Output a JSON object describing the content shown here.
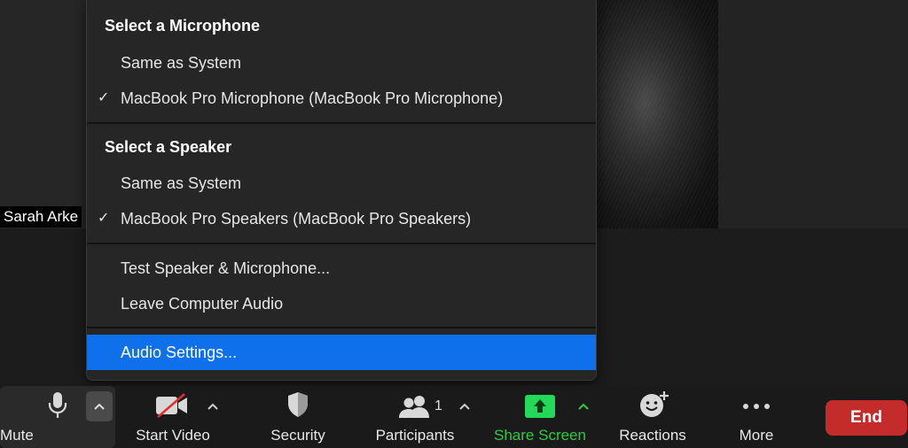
{
  "video": {
    "participant_name": "Sarah Arke"
  },
  "audio_menu": {
    "microphone_header": "Select a Microphone",
    "microphone_options": [
      {
        "label": "Same as System",
        "checked": false
      },
      {
        "label": "MacBook Pro Microphone (MacBook Pro Microphone)",
        "checked": true
      }
    ],
    "speaker_header": "Select a Speaker",
    "speaker_options": [
      {
        "label": "Same as System",
        "checked": false
      },
      {
        "label": "MacBook Pro Speakers (MacBook Pro Speakers)",
        "checked": true
      }
    ],
    "actions": [
      {
        "label": "Test Speaker & Microphone..."
      },
      {
        "label": "Leave Computer Audio"
      }
    ],
    "settings_label": "Audio Settings...",
    "check_glyph": "✓"
  },
  "toolbar": {
    "mute_label": "Mute",
    "start_video_label": "Start Video",
    "security_label": "Security",
    "participants_label": "Participants",
    "participants_count": "1",
    "share_screen_label": "Share Screen",
    "reactions_label": "Reactions",
    "more_label": "More",
    "end_label": "End"
  },
  "colors": {
    "highlight": "#0e71eb",
    "share_green": "#2ecc40",
    "end_red": "#c42c2c"
  }
}
